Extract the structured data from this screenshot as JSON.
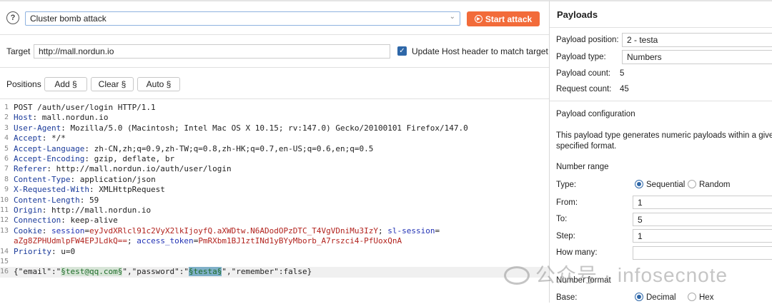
{
  "attack": {
    "type": "Cluster bomb attack",
    "start_label": "Start attack"
  },
  "target": {
    "label": "Target",
    "value": "http://mall.nordun.io",
    "update_host_label": "Update Host header to match target",
    "update_host_checked": true
  },
  "positions": {
    "label": "Positions",
    "add": "Add §",
    "clear": "Clear §",
    "auto": "Auto §"
  },
  "request": [
    [
      [
        "v",
        "POST /auth/user/login HTTP/1.1"
      ]
    ],
    [
      [
        "k",
        "Host"
      ],
      [
        "v",
        ": mall.nordun.io"
      ]
    ],
    [
      [
        "k",
        "User-Agent"
      ],
      [
        "v",
        ": Mozilla/5.0 (Macintosh; Intel Mac OS X 10.15; rv:147.0) Gecko/20100101 Firefox/147.0"
      ]
    ],
    [
      [
        "k",
        "Accept"
      ],
      [
        "v",
        ": */*"
      ]
    ],
    [
      [
        "k",
        "Accept-Language"
      ],
      [
        "v",
        ": zh-CN,zh;q=0.9,zh-TW;q=0.8,zh-HK;q=0.7,en-US;q=0.6,en;q=0.5"
      ]
    ],
    [
      [
        "k",
        "Accept-Encoding"
      ],
      [
        "v",
        ": gzip, deflate, br"
      ]
    ],
    [
      [
        "k",
        "Referer"
      ],
      [
        "v",
        ": http://mall.nordun.io/auth/user/login"
      ]
    ],
    [
      [
        "k",
        "Content-Type"
      ],
      [
        "v",
        ": application/json"
      ]
    ],
    [
      [
        "k",
        "X-Requested-With"
      ],
      [
        "v",
        ": XMLHttpRequest"
      ]
    ],
    [
      [
        "k",
        "Content-Length"
      ],
      [
        "v",
        ": 59"
      ]
    ],
    [
      [
        "k",
        "Origin"
      ],
      [
        "v",
        ": http://mall.nordun.io"
      ]
    ],
    [
      [
        "k",
        "Connection"
      ],
      [
        "v",
        ": keep-alive"
      ]
    ],
    [
      [
        "k",
        "Cookie"
      ],
      [
        "v",
        ": "
      ],
      [
        "b",
        "session"
      ],
      [
        "v",
        "="
      ],
      [
        "r",
        "eyJvdXRlcl91c2VyX2lkIjoyfQ.aXWDtw.N6ADodOPzDTC_T4VgVDniMu3IzY"
      ],
      [
        "v",
        "; "
      ],
      [
        "b",
        "sl-session"
      ],
      [
        "v",
        "="
      ]
    ],
    [
      [
        "r",
        "aZg8ZPHUdmlpFW4EPJLdkQ=="
      ],
      [
        "v",
        "; "
      ],
      [
        "b",
        "access_token"
      ],
      [
        "v",
        "="
      ],
      [
        "r",
        "PmRXbm1BJ1ztINd1yBYyMborb_A7rszci4-PfUoxQnA"
      ]
    ],
    [
      [
        "k",
        "Priority"
      ],
      [
        "v",
        ": u=0"
      ]
    ],
    [],
    [
      [
        "v",
        "{\"email\":\""
      ],
      [
        "hl1",
        "§test@qq.com§"
      ],
      [
        "v",
        "\",\"password\":\""
      ],
      [
        "hl2",
        "§testa§"
      ],
      [
        "v",
        "\",\"remember\":false}"
      ]
    ]
  ],
  "line_numbers": [
    "1",
    "2",
    "3",
    "4",
    "5",
    "6",
    "7",
    "8",
    "9",
    "10",
    "11",
    "12",
    "13",
    "",
    "14",
    "15",
    "16"
  ],
  "payloads": {
    "title": "Payloads",
    "position_label": "Payload position:",
    "position_value": "2 - testa",
    "type_label": "Payload type:",
    "type_value": "Numbers",
    "count_label": "Payload count:",
    "count_value": "5",
    "request_count_label": "Request count:",
    "request_count_value": "45",
    "config_title": "Payload configuration",
    "config_desc_1": "This payload type generates numeric payloads within a given",
    "config_desc_2": "specified format.",
    "range_title": "Number range",
    "type_row_label": "Type:",
    "sequential": "Sequential",
    "random": "Random",
    "from_label": "From:",
    "from_value": "1",
    "to_label": "To:",
    "to_value": "5",
    "step_label": "Step:",
    "step_value": "1",
    "how_many_label": "How many:",
    "how_many_value": "",
    "format_title": "Number format",
    "base_label": "Base:",
    "decimal": "Decimal",
    "hex": "Hex"
  },
  "watermark": "公众号 · infosecnote"
}
